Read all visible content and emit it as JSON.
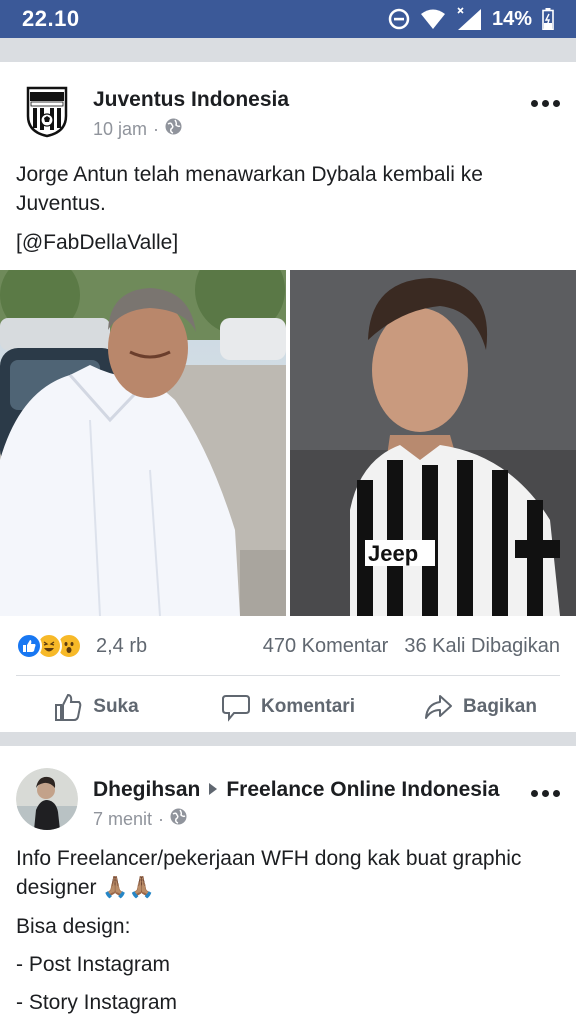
{
  "status_bar": {
    "time": "22.10",
    "battery": "14%"
  },
  "post1": {
    "page_name": "Juventus Indonesia",
    "time": "10 jam",
    "separator": "·",
    "text_line1": "Jorge Antun telah menawarkan Dybala kembali ke Juventus.",
    "text_line2": "[@FabDellaValle]",
    "reactions_count": "2,4 rb",
    "comments": "470 Komentar",
    "shares": "36 Kali Dibagikan",
    "actions": {
      "like": "Suka",
      "comment": "Komentari",
      "share": "Bagikan"
    },
    "reaction_icons": [
      "like-icon",
      "haha-icon",
      "wow-icon"
    ]
  },
  "post2": {
    "author": "Dhegihsan",
    "group": "Freelance Online Indonesia",
    "time": "7 menit",
    "separator": "·",
    "text_line1": "Info Freelancer/pekerjaan WFH dong kak buat graphic designer 🙏🏽🙏🏽",
    "text_line2": "Bisa design:",
    "text_line3": "- Post Instagram",
    "text_line4": "- Story Instagram"
  },
  "colors": {
    "status_bar": "#3b5998",
    "like_blue": "#1877f2",
    "muted_text": "#606770"
  }
}
